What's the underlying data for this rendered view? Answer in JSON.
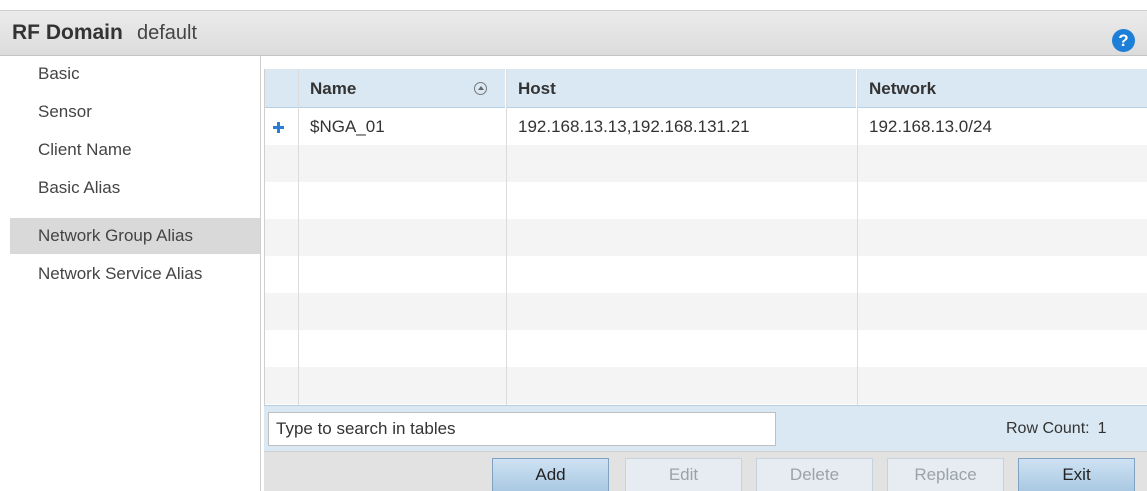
{
  "header": {
    "title": "RF Domain",
    "subtitle": "default",
    "help_icon": "help-icon",
    "help_glyph": "?"
  },
  "sidebar": {
    "items": [
      {
        "label": "Basic",
        "active": false
      },
      {
        "label": "Sensor",
        "active": false
      },
      {
        "label": "Client Name",
        "active": false
      },
      {
        "label": "Basic Alias",
        "active": false
      },
      {
        "label": "Network Group Alias",
        "active": true
      },
      {
        "label": "Network Service Alias",
        "active": false
      }
    ]
  },
  "table": {
    "columns": [
      "Name",
      "Host",
      "Network"
    ],
    "rows": [
      {
        "name": "$NGA_01",
        "host": "192.168.13.13,192.168.131.21",
        "network": "192.168.13.0/24"
      }
    ]
  },
  "search": {
    "placeholder": "Type to search in tables",
    "value": ""
  },
  "row_count": {
    "label": "Row Count:",
    "value": "1"
  },
  "buttons": {
    "add": "Add",
    "edit": "Edit",
    "delete": "Delete",
    "replace": "Replace",
    "exit": "Exit"
  },
  "colors": {
    "accent": "#1e7fd8",
    "header_bg": "#d9e8f3",
    "active_item": "#d9d9d9"
  }
}
